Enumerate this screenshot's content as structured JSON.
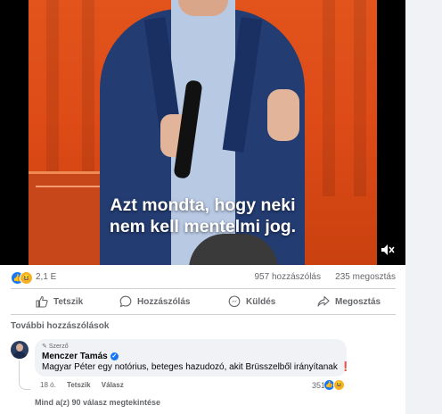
{
  "video": {
    "subtitle_line1": "Azt mondta, hogy neki",
    "subtitle_line2": "nem kell mentelmi jog.",
    "mute_icon": "speaker-muted-icon"
  },
  "stats": {
    "reactions": [
      "like",
      "haha"
    ],
    "reaction_count": "2,1 E",
    "comments": "957 hozzászólás",
    "shares": "235 megosztás"
  },
  "actions": {
    "like": "Tetszik",
    "comment": "Hozzászólás",
    "send": "Küldés",
    "share": "Megosztás"
  },
  "comments_section": {
    "more_label": "További hozzászólások",
    "comment": {
      "badge": "Szerző",
      "author": "Menczer Tamás",
      "text": "Magyar Péter egy notórius, beteges hazudozó, akit Brüsszelből irányítanak",
      "time": "18 ó.",
      "like_label": "Tetszik",
      "reply_label": "Válasz",
      "reaction_count": "351"
    },
    "view_replies": "Mind a(z) 90 válasz megtekintése"
  },
  "colors": {
    "accent": "#1877f2",
    "muted_text": "#65676b",
    "bubble": "#f0f2f5",
    "video_bg": "#e2541c"
  }
}
